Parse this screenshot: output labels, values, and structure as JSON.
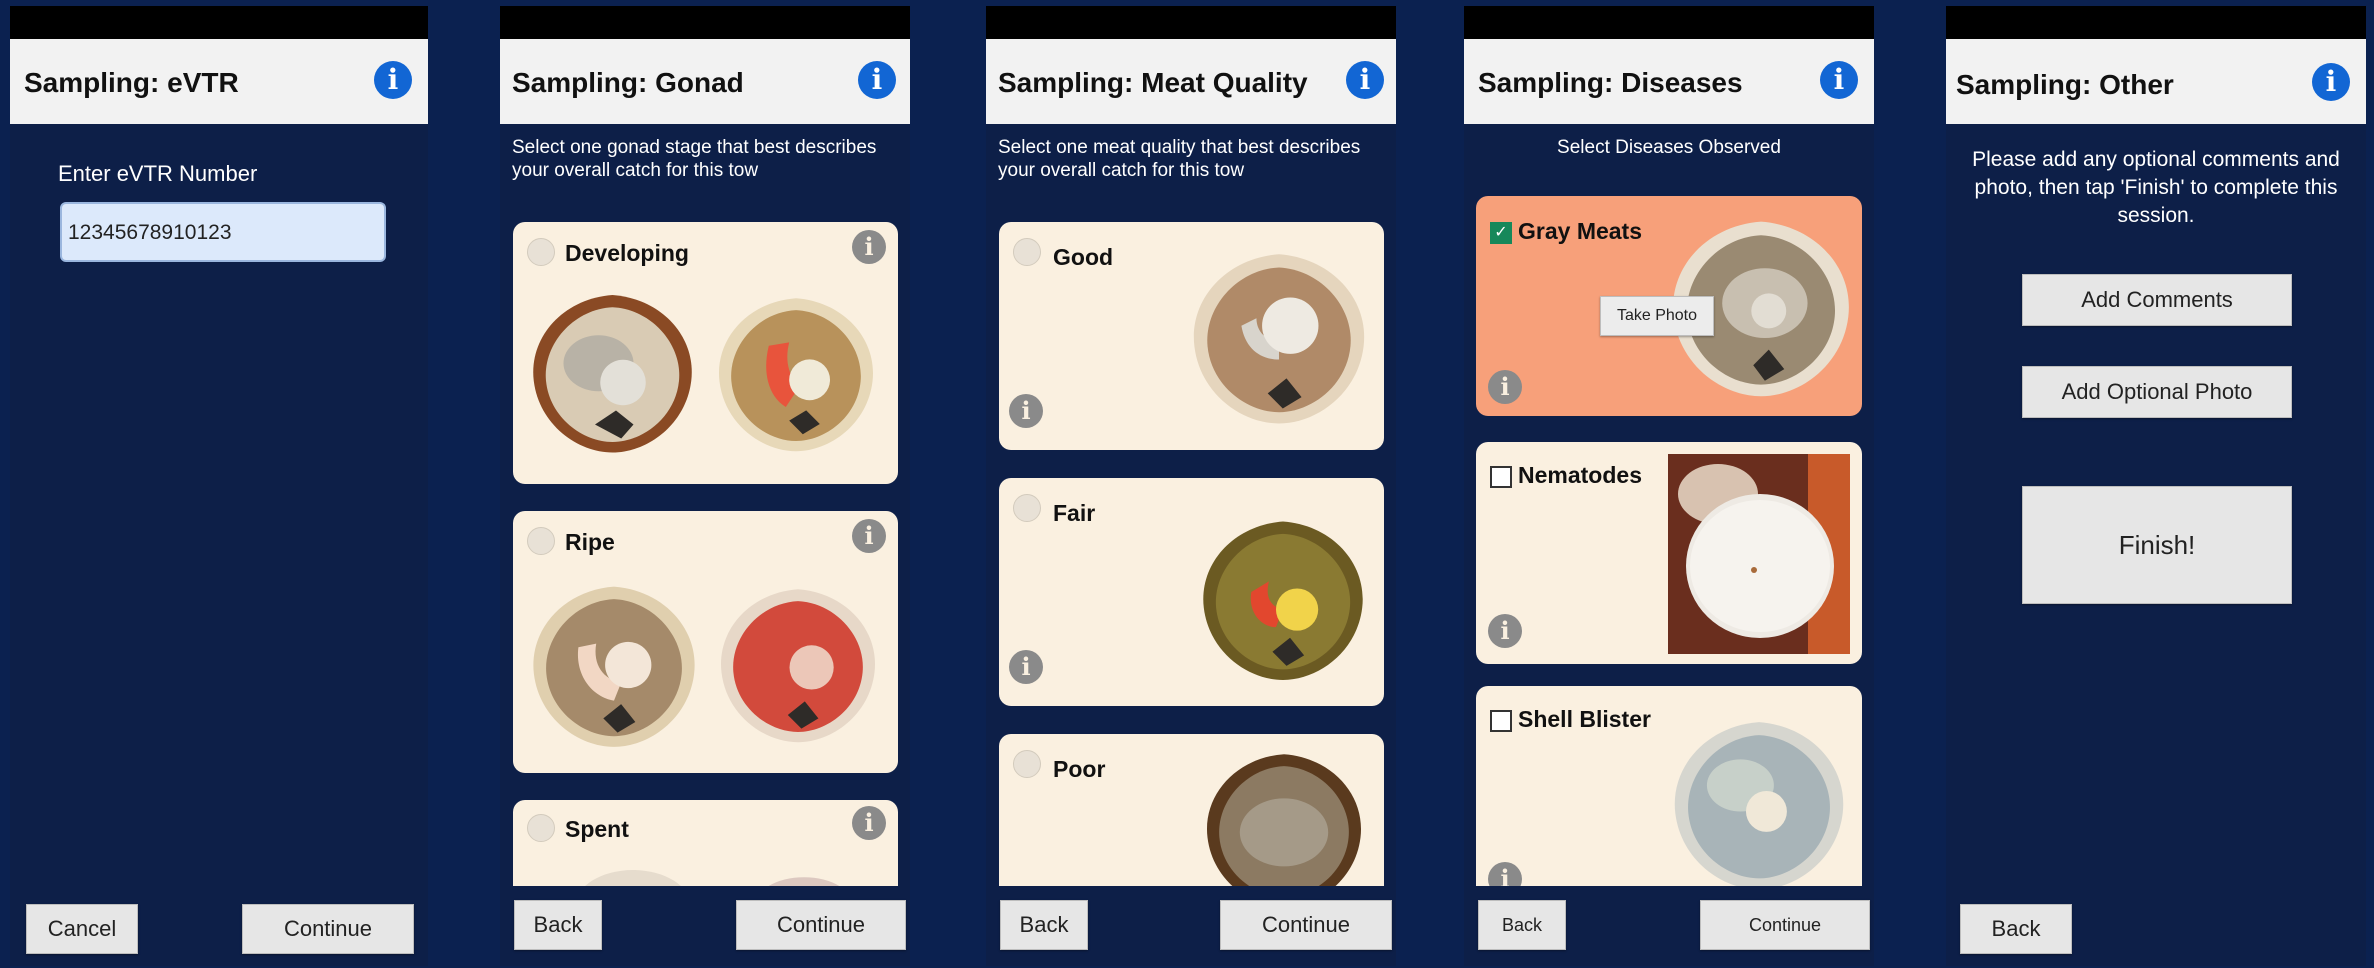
{
  "screens": {
    "evtr": {
      "title": "Sampling: eVTR",
      "field_label": "Enter eVTR Number",
      "field_value": "12345678910123",
      "cancel_label": "Cancel",
      "continue_label": "Continue"
    },
    "gonad": {
      "title": "Sampling: Gonad",
      "prompt_line1": "Select one gonad stage that best describes",
      "prompt_line2": "your overall catch for this tow",
      "options": [
        "Developing",
        "Ripe",
        "Spent"
      ],
      "back_label": "Back",
      "continue_label": "Continue"
    },
    "meat": {
      "title": "Sampling: Meat Quality",
      "prompt_line1": "Select one meat quality that best describes",
      "prompt_line2": "your overall catch for this tow",
      "options": [
        "Good",
        "Fair",
        "Poor"
      ],
      "back_label": "Back",
      "continue_label": "Continue"
    },
    "diseases": {
      "title": "Sampling: Diseases",
      "prompt": "Select Diseases Observed",
      "options": [
        {
          "label": "Gray Meats",
          "checked": true
        },
        {
          "label": "Nematodes",
          "checked": false
        },
        {
          "label": "Shell Blister",
          "checked": false
        }
      ],
      "take_photo_label": "Take Photo",
      "selected_color": "#f7a07a",
      "back_label": "Back",
      "continue_label": "Continue"
    },
    "other": {
      "title": "Sampling: Other",
      "prompt_line1": "Please add any optional comments and",
      "prompt_line2": "photo, then tap 'Finish' to complete this",
      "prompt_line3": "session.",
      "add_comments_label": "Add Comments",
      "add_photo_label": "Add Optional Photo",
      "finish_label": "Finish!",
      "back_label": "Back"
    }
  },
  "icons": {
    "info_glyph": "i",
    "check_glyph": "✓"
  },
  "colors": {
    "background": "#0d1f48",
    "appbar": "#f2f2f2",
    "info_blue": "#1266d4",
    "card": "#faf0e0",
    "selected_card": "#f7a07a",
    "checkbox_checked": "#16885a"
  }
}
